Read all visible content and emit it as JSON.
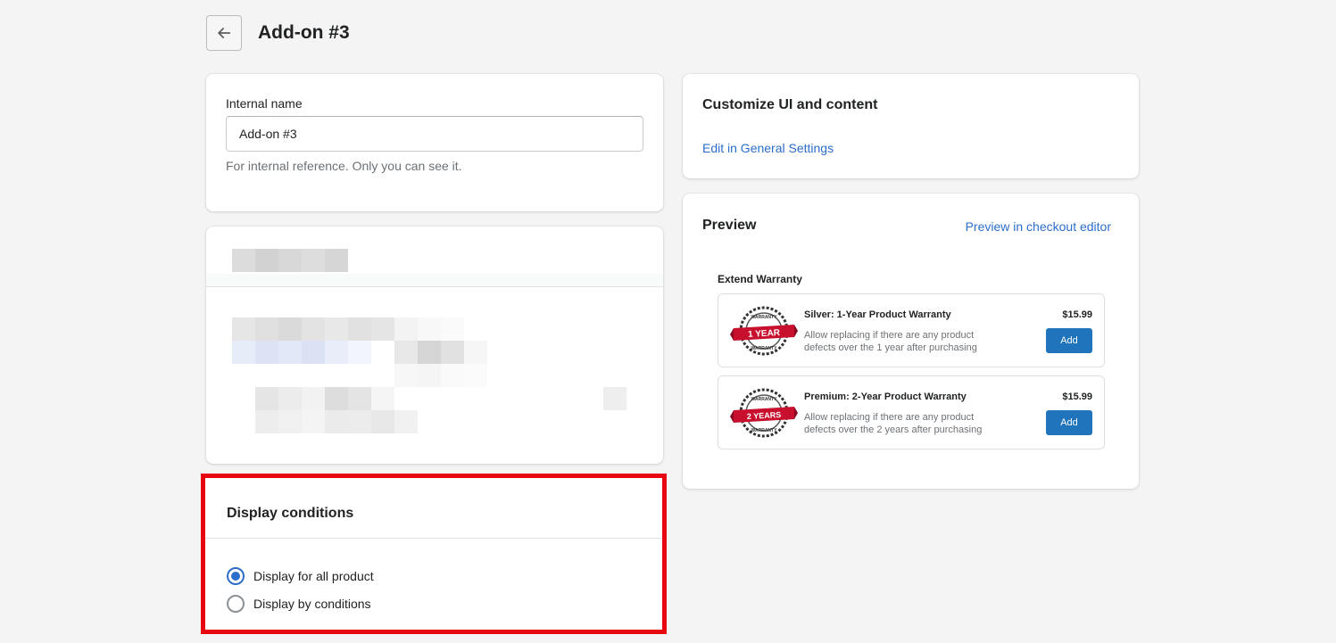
{
  "header": {
    "title": "Add-on #3"
  },
  "internal_name": {
    "label": "Internal name",
    "value": "Add-on #3",
    "help": "For internal reference. Only you can see it."
  },
  "display_conditions": {
    "title": "Display conditions",
    "options": [
      {
        "label": "Display for all product",
        "selected": true
      },
      {
        "label": "Display by conditions",
        "selected": false
      }
    ]
  },
  "customize": {
    "title": "Customize UI and content",
    "link": "Edit in General Settings"
  },
  "preview": {
    "title": "Preview",
    "link": "Preview in checkout editor",
    "widget_title": "Extend Warranty",
    "offers": [
      {
        "name": "Silver: 1-Year Product Warranty",
        "desc_line1": "Allow replacing if there are any product",
        "desc_line2": "defects over the 1 year after purchasing",
        "price": "$15.99",
        "button": "Add",
        "badge_top": "WARRANTY",
        "badge_main": "1 YEAR",
        "badge_bottom": "WARRANTY"
      },
      {
        "name": "Premium: 2-Year Product Warranty",
        "desc_line1": "Allow replacing if there are any product",
        "desc_line2": "defects over the 2 years after purchasing",
        "price": "$15.99",
        "button": "Add",
        "badge_top": "WARRANTY",
        "badge_main": "2 YEARS",
        "badge_bottom": "WARRANTY"
      }
    ]
  },
  "colors": {
    "accent": "#2c6ecb",
    "highlight_border": "#e8070f",
    "add_button": "#1f74bb",
    "badge_ribbon": "#c8102e"
  }
}
